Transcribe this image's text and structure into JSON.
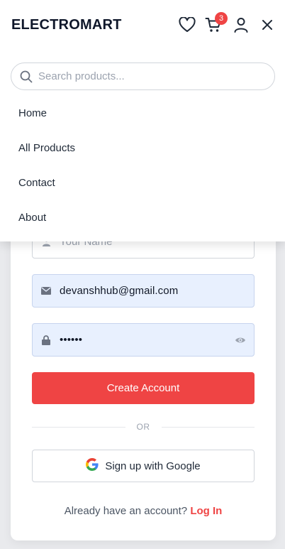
{
  "header": {
    "brand": "ELECTROMART",
    "cart_count": "3"
  },
  "search": {
    "placeholder": "Search products..."
  },
  "menu": {
    "items": [
      {
        "label": "Home"
      },
      {
        "label": "All Products"
      },
      {
        "label": "Contact"
      },
      {
        "label": "About"
      }
    ]
  },
  "signup": {
    "name_placeholder": "Your Name",
    "email_value": "devanshhub@gmail.com",
    "password_value": "••••••",
    "create_label": "Create Account",
    "or_label": "OR",
    "google_label": "Sign up with Google",
    "login_prompt": "Already have an account?",
    "login_link": "Log In"
  },
  "colors": {
    "accent": "#ef4444",
    "autofill": "#e8f0fe"
  }
}
